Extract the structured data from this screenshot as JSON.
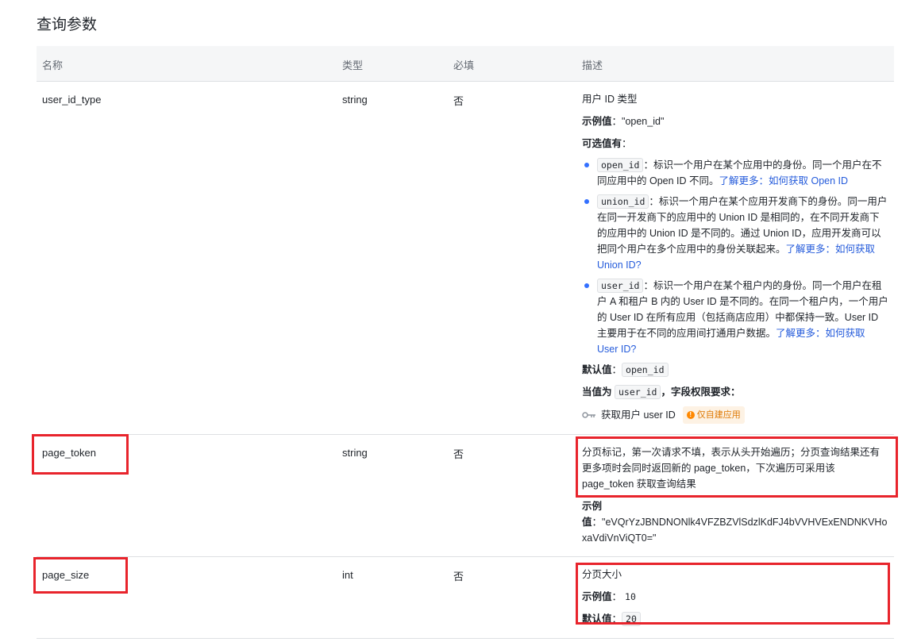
{
  "page_title": "查询参数",
  "columns": {
    "name": "名称",
    "type": "类型",
    "required": "必填",
    "description": "描述"
  },
  "rows": [
    {
      "name": "user_id_type",
      "type": "string",
      "required": "否",
      "summary": "用户 ID 类型",
      "example_label": "示例值",
      "example_value": "：\"open_id\"",
      "options_label": "可选值有",
      "options_colon": "：",
      "options": [
        {
          "code": "open_id",
          "text": "：标识一个用户在某个应用中的身份。同一个用户在不同应用中的 Open ID 不同。",
          "link": "了解更多：如何获取 Open ID"
        },
        {
          "code": "union_id",
          "text": "：标识一个用户在某个应用开发商下的身份。同一用户在同一开发商下的应用中的 Union ID 是相同的，在不同开发商下的应用中的 Union ID 是不同的。通过 Union ID，应用开发商可以把同个用户在多个应用中的身份关联起来。",
          "link": "了解更多：如何获取 Union ID?"
        },
        {
          "code": "user_id",
          "text": "：标识一个用户在某个租户内的身份。同一个用户在租户 A 和租户 B 内的 User ID 是不同的。在同一个租户内，一个用户的 User ID 在所有应用（包括商店应用）中都保持一致。User ID 主要用于在不同的应用间打通用户数据。",
          "link": "了解更多：如何获取 User ID?"
        }
      ],
      "default_label": "默认值",
      "default_colon": "：",
      "default_value": "open_id",
      "condition_prefix": "当值为",
      "condition_code": "user_id",
      "condition_suffix": "，字段权限要求：",
      "permission_text": "获取用户 user ID",
      "permission_badge": "仅自建应用",
      "badge_icon": "!"
    },
    {
      "name": "page_token",
      "type": "string",
      "required": "否",
      "summary": "分页标记，第一次请求不填，表示从头开始遍历；分页查询结果还有更多项时会同时返回新的 page_token，下次遍历可采用该 page_token 获取查询结果",
      "example_label": "示例",
      "example_value_label": "值",
      "example_value": "：\"eVQrYzJBNDNONlk4VFZBZVlSdzlKdFJ4bVVHVExENDNKVHoxaVdiVnViQT0=\""
    },
    {
      "name": "page_size",
      "type": "int",
      "required": "否",
      "summary": "分页大小",
      "example_label": "示例值",
      "example_colon": "：",
      "example_value": "10",
      "default_label": "默认值",
      "default_colon": "：",
      "default_value": "20"
    }
  ],
  "highlight_color": "#e8242c",
  "link_color": "#245bdb",
  "bullet_color": "#3370ff",
  "icons": {
    "permission": "key-icon",
    "badge": "warning-icon"
  }
}
